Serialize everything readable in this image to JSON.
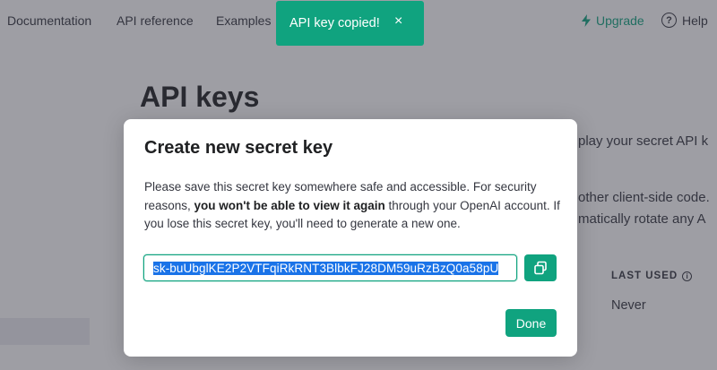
{
  "nav": {
    "documentation": "Documentation",
    "api_reference": "API reference",
    "examples": "Examples",
    "upgrade": "Upgrade",
    "help": "Help",
    "help_icon_glyph": "?"
  },
  "page": {
    "title": "API keys",
    "background_lines": [
      "play your secret API k",
      "other client-side code.",
      "matically rotate any A"
    ],
    "table": {
      "header_last_used": "LAST USED",
      "info_glyph": "i",
      "last_used_value": "Never"
    }
  },
  "modal": {
    "title": "Create new secret key",
    "body_before": "Please save this secret key somewhere safe and accessible. For security reasons, ",
    "body_bold": "you won't be able to view it again",
    "body_after": " through your OpenAI account. If you lose this secret key, you'll need to generate a new one.",
    "secret_key": "sk-buUbglKE2P2VTFqiRkRNT3BlbkFJ28DM59uRzBzQ0a58pU",
    "copy_icon": "copy-icon",
    "done_label": "Done"
  },
  "toast": {
    "message": "API key copied!",
    "close_glyph": "×"
  },
  "colors": {
    "accent": "#10a37f",
    "selection": "#1a73e8",
    "overlay": "rgba(52,53,65,0.48)"
  }
}
